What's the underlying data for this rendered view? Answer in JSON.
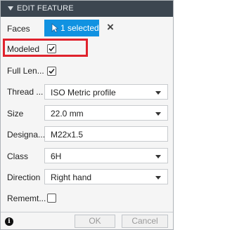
{
  "dialog": {
    "title": "EDIT FEATURE"
  },
  "faces": {
    "label": "Faces",
    "button_label": "1 selected"
  },
  "modeled": {
    "label": "Modeled",
    "checked": true
  },
  "full_length": {
    "label": "Full Len...",
    "checked": true
  },
  "thread_type": {
    "label": "Thread ...",
    "value": "ISO Metric profile"
  },
  "size": {
    "label": "Size",
    "value": "22.0 mm"
  },
  "designation": {
    "label": "Designa...",
    "value": "M22x1.5"
  },
  "class": {
    "label": "Class",
    "value": "6H"
  },
  "direction": {
    "label": "Direction",
    "value": "Right hand"
  },
  "remember": {
    "label": "Rememt...",
    "checked": false
  },
  "footer": {
    "info_glyph": "i",
    "ok_label": "OK",
    "cancel_label": "Cancel"
  },
  "colors": {
    "titlebar": "#3c4650",
    "selection": "#1192e1",
    "highlight": "#e0222d"
  }
}
